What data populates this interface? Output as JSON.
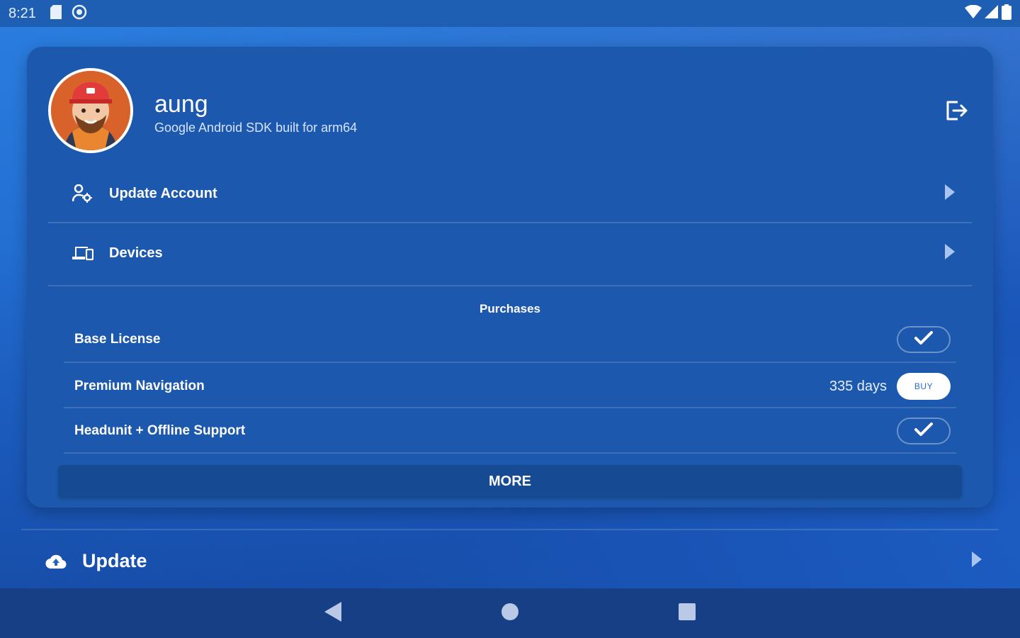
{
  "status_bar": {
    "time": "8:21"
  },
  "profile": {
    "name": "aung",
    "device": "Google Android SDK built for arm64"
  },
  "menu": {
    "items": [
      {
        "label": "Update Account",
        "icon": "account-settings-icon"
      },
      {
        "label": "Devices",
        "icon": "devices-icon"
      }
    ]
  },
  "purchases": {
    "title": "Purchases",
    "items": [
      {
        "label": "Base License",
        "status": "owned"
      },
      {
        "label": "Premium Navigation",
        "status": "buy",
        "days": "335 days",
        "button_label": "BUY"
      },
      {
        "label": "Headunit + Offline Support",
        "status": "owned"
      }
    ],
    "more_label": "MORE"
  },
  "update": {
    "label": "Update",
    "icon": "cloud-icon"
  },
  "colors": {
    "background": "#1e63c8",
    "card": "#1c58ad",
    "nav_bar": "#173f85",
    "more_button": "#164a92"
  }
}
